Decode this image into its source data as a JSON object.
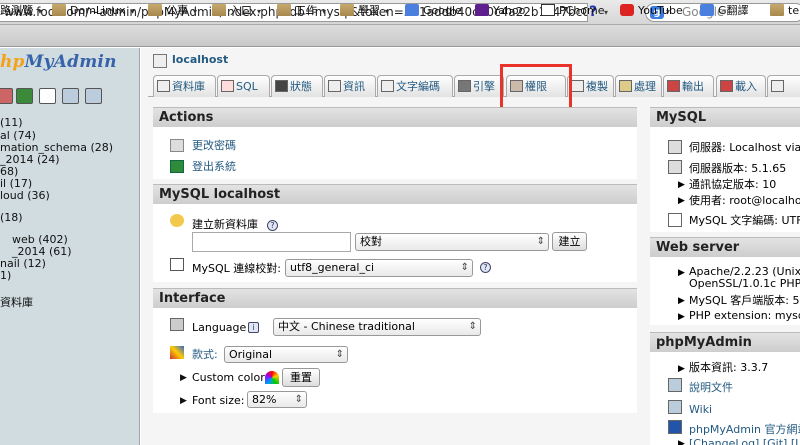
{
  "browser": {
    "url": "www.foo.dom/~admin/phpMyAdmin/index.php?db=mysql&token=371addb40c70c4a22b1c47bc01",
    "search_placeholder": "Google",
    "bookmarks": {
      "first": "路測覽",
      "domlinux": "DomLinux",
      "public": "公事",
      "entry": "入口",
      "work": "工作",
      "study": "學習",
      "google": "Google",
      "yahoo": "Yahoo",
      "pchome": "PChome",
      "youtube": "YouTube",
      "gtranslate": "G翻譯",
      "tem": "tem"
    }
  },
  "left": {
    "logo_part1": "hp",
    "logo_part2": "MyAdmin",
    "databases": [
      "(11)",
      "al (74)",
      "mation_schema (28)",
      "_2014 (24)",
      "68)",
      "il (17)",
      "loud (36)",
      "(18)",
      "web (402)",
      "_2014 (61)",
      "nail (12)",
      "1)",
      "資料庫"
    ]
  },
  "main": {
    "server": "localhost",
    "tabs": {
      "databases": "資料庫",
      "sql": "SQL",
      "status": "狀態",
      "variables": "資訊",
      "charsets": "文字編碼",
      "engines": "引擎",
      "privileges": "權限",
      "replication": "複製",
      "processes": "處理",
      "export": "輸出",
      "import": "載入"
    },
    "actions": {
      "title": "Actions",
      "change_password": "更改密碼",
      "logout": "登出系統"
    },
    "mysql_local": {
      "title": "MySQL localhost",
      "create_db_label": "建立新資料庫",
      "create_db_value": "",
      "collation_placeholder": "校對",
      "create_button": "建立",
      "connection_collation_label": "MySQL 連線校對:",
      "connection_collation_value": "utf8_general_ci"
    },
    "interface": {
      "title": "Interface",
      "language_label": "Language",
      "language_value": "中文 - Chinese traditional",
      "theme_label": "款式:",
      "theme_value": "Original",
      "custom_color_label": "Custom color:",
      "reset_button": "重置",
      "font_size_label": "Font size:",
      "font_size_value": "82%"
    }
  },
  "right": {
    "mysql": {
      "title": "MySQL",
      "server": "伺服器: Localhost via",
      "version": "伺服器版本: 5.1.65",
      "protocol": "通訊協定版本: 10",
      "user": "使用者: root@localhos",
      "charset": "MySQL 文字編碼: UTF"
    },
    "webserver": {
      "title": "Web server",
      "apache_line1": "Apache/2.2.23 (Unix)",
      "apache_line2": "OpenSSL/1.0.1c PHP",
      "client": "MySQL 客戶端版本: 5",
      "php_ext": "PHP extension: mysq"
    },
    "pma": {
      "title": "phpMyAdmin",
      "version": "版本資訊: 3.3.7",
      "docs": "說明文件",
      "wiki": "Wiki",
      "homepage": "phpMyAdmin 官方網站",
      "changelog": "[ChangeLog] [Git] [Li"
    }
  },
  "colors": {
    "highlight": "#e8322a",
    "link": "#235a81",
    "logo_orange": "#f5a21b",
    "logo_blue": "#3763a9"
  }
}
